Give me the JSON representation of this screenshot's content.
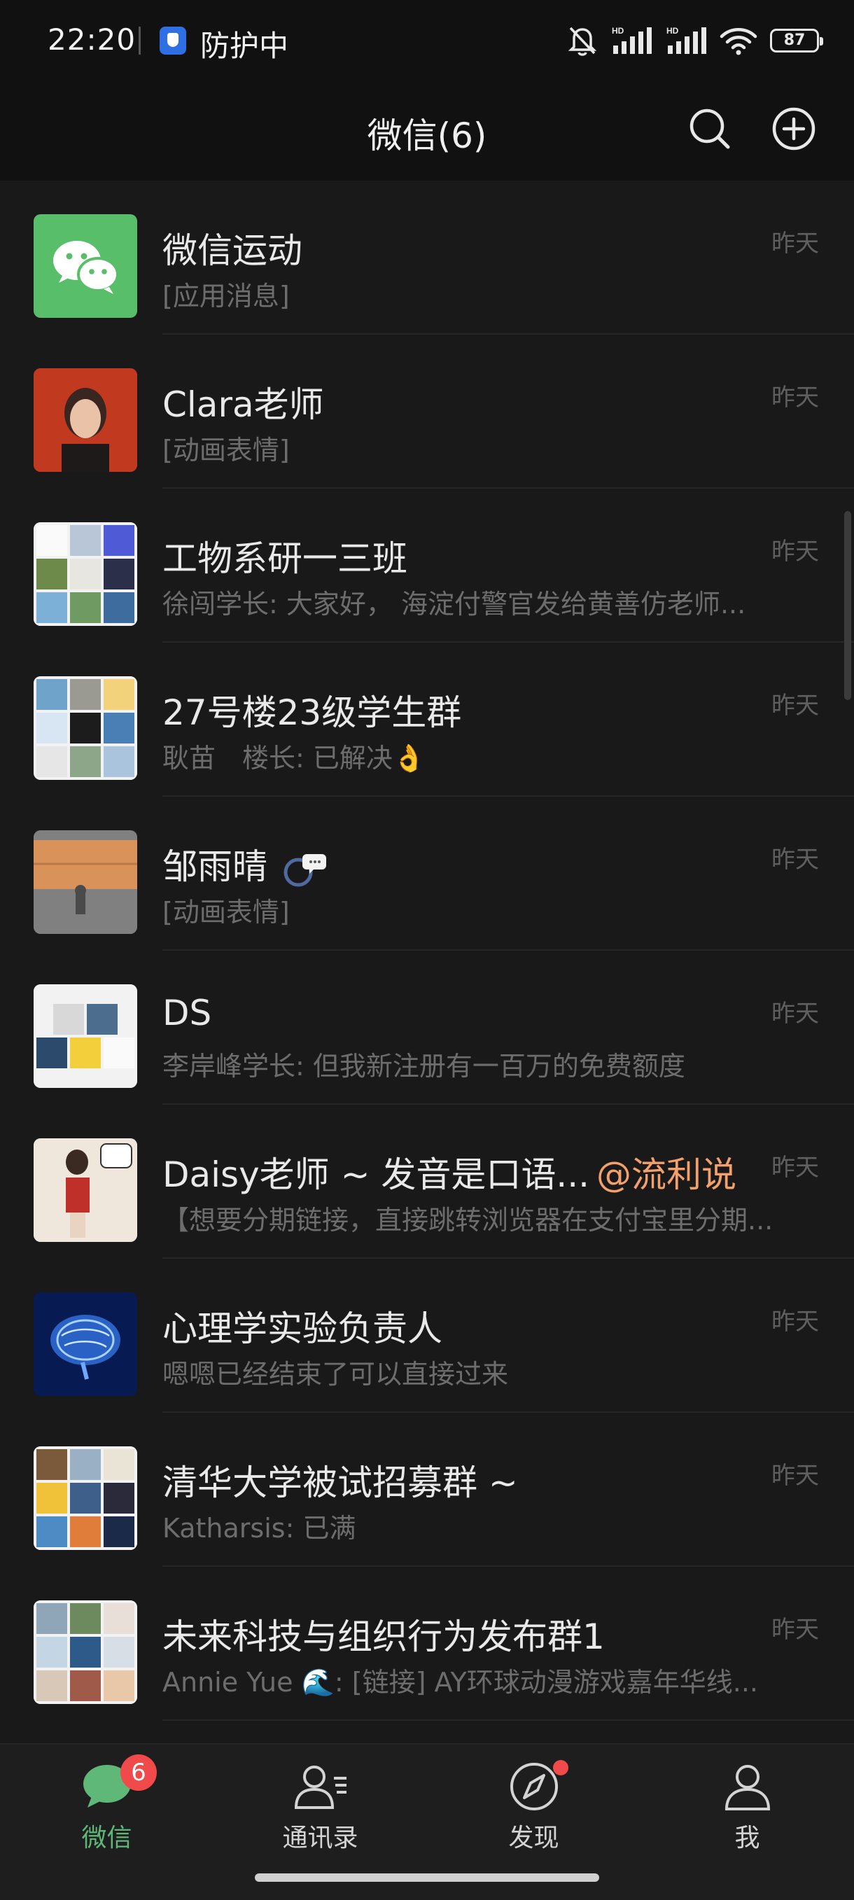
{
  "status_bar": {
    "time": "22:20",
    "guard_label": "防护中",
    "battery": "87",
    "icons": [
      "shield-icon",
      "mute-bell-icon",
      "signal-icon",
      "signal-icon",
      "wifi-icon",
      "battery-icon"
    ]
  },
  "header": {
    "title": "微信(6)",
    "search_icon": "search-icon",
    "add_icon": "plus-circle-icon"
  },
  "chats": [
    {
      "name": "微信运动",
      "preview": "[应用消息]",
      "time": "昨天"
    },
    {
      "name": "Clara老师",
      "preview": "[动画表情]",
      "time": "昨天"
    },
    {
      "name": "工物系研一三班",
      "preview": "徐闯学长: 大家好， 海淀付警官发给黄善仿老师...",
      "time": "昨天"
    },
    {
      "name": "27号楼23级学生群",
      "preview": "耿苗　楼长: 已解决👌",
      "time": "昨天"
    },
    {
      "name": "邹雨晴",
      "preview": "[动画表情]",
      "time": "昨天"
    },
    {
      "name": "DS",
      "preview": "李岸峰学长: 但我新注册有一百万的免费额度",
      "time": "昨天"
    },
    {
      "name": "Daisy老师 ~ 发音是口语...",
      "mention": "@流利说",
      "preview": "【想要分期链接，直接跳转浏览器在支付宝里分期...",
      "time": "昨天"
    },
    {
      "name": "心理学实验负责人",
      "preview": "嗯嗯已经结束了可以直接过来",
      "time": "昨天"
    },
    {
      "name": "清华大学被试招募群 ~",
      "preview": "Katharsis: 已满",
      "time": "昨天"
    },
    {
      "name": "未来科技与组织行为发布群1",
      "preview": "Annie Yue 🌊: [链接] AY环球动漫游戏嘉年华线...",
      "time": "昨天"
    }
  ],
  "bottom_nav": {
    "tabs": [
      {
        "label": "微信",
        "icon": "chat-bubble-icon",
        "badge": "6"
      },
      {
        "label": "通讯录",
        "icon": "contacts-icon"
      },
      {
        "label": "发现",
        "icon": "compass-icon"
      },
      {
        "label": "我",
        "icon": "person-icon"
      }
    ]
  },
  "colors": {
    "accent_green": "#5fb878",
    "badge_red": "#f04a4a",
    "mention_orange": "#f3a06a",
    "wechat_green": "#58be6a"
  }
}
